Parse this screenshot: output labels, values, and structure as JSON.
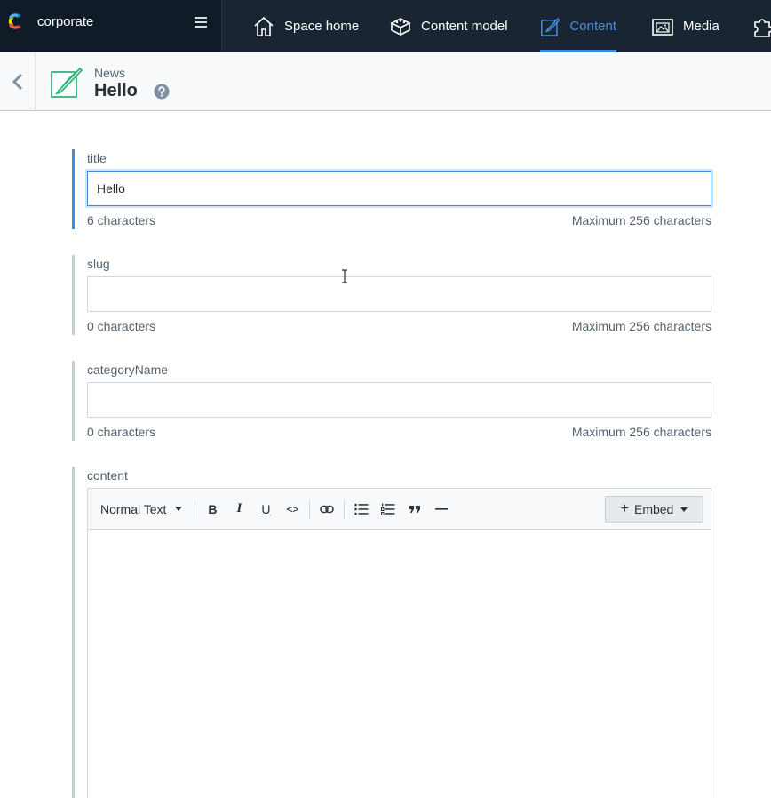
{
  "app": {
    "space_name": "corporate",
    "nav": [
      {
        "label": "Space home",
        "icon": "home-icon"
      },
      {
        "label": "Content model",
        "icon": "content-model-icon"
      },
      {
        "label": "Content",
        "icon": "content-icon",
        "active": true
      },
      {
        "label": "Media",
        "icon": "media-icon"
      }
    ],
    "accent_color": "#3f8cdd"
  },
  "entry": {
    "content_type": "News",
    "title": "Hello"
  },
  "fields": {
    "title": {
      "label": "title",
      "value": "Hello ",
      "count": "6 characters",
      "max": "Maximum 256 characters"
    },
    "slug": {
      "label": "slug",
      "value": "",
      "count": "0 characters",
      "max": "Maximum 256 characters"
    },
    "categoryName": {
      "label": "categoryName",
      "value": "",
      "count": "0 characters",
      "max": "Maximum 256 characters"
    },
    "content": {
      "label": "content"
    }
  },
  "rte": {
    "format": "Normal Text",
    "bold": "B",
    "italic": "I",
    "underline": "U",
    "code": "<>",
    "embed": "Embed",
    "embed_plus": "+"
  }
}
